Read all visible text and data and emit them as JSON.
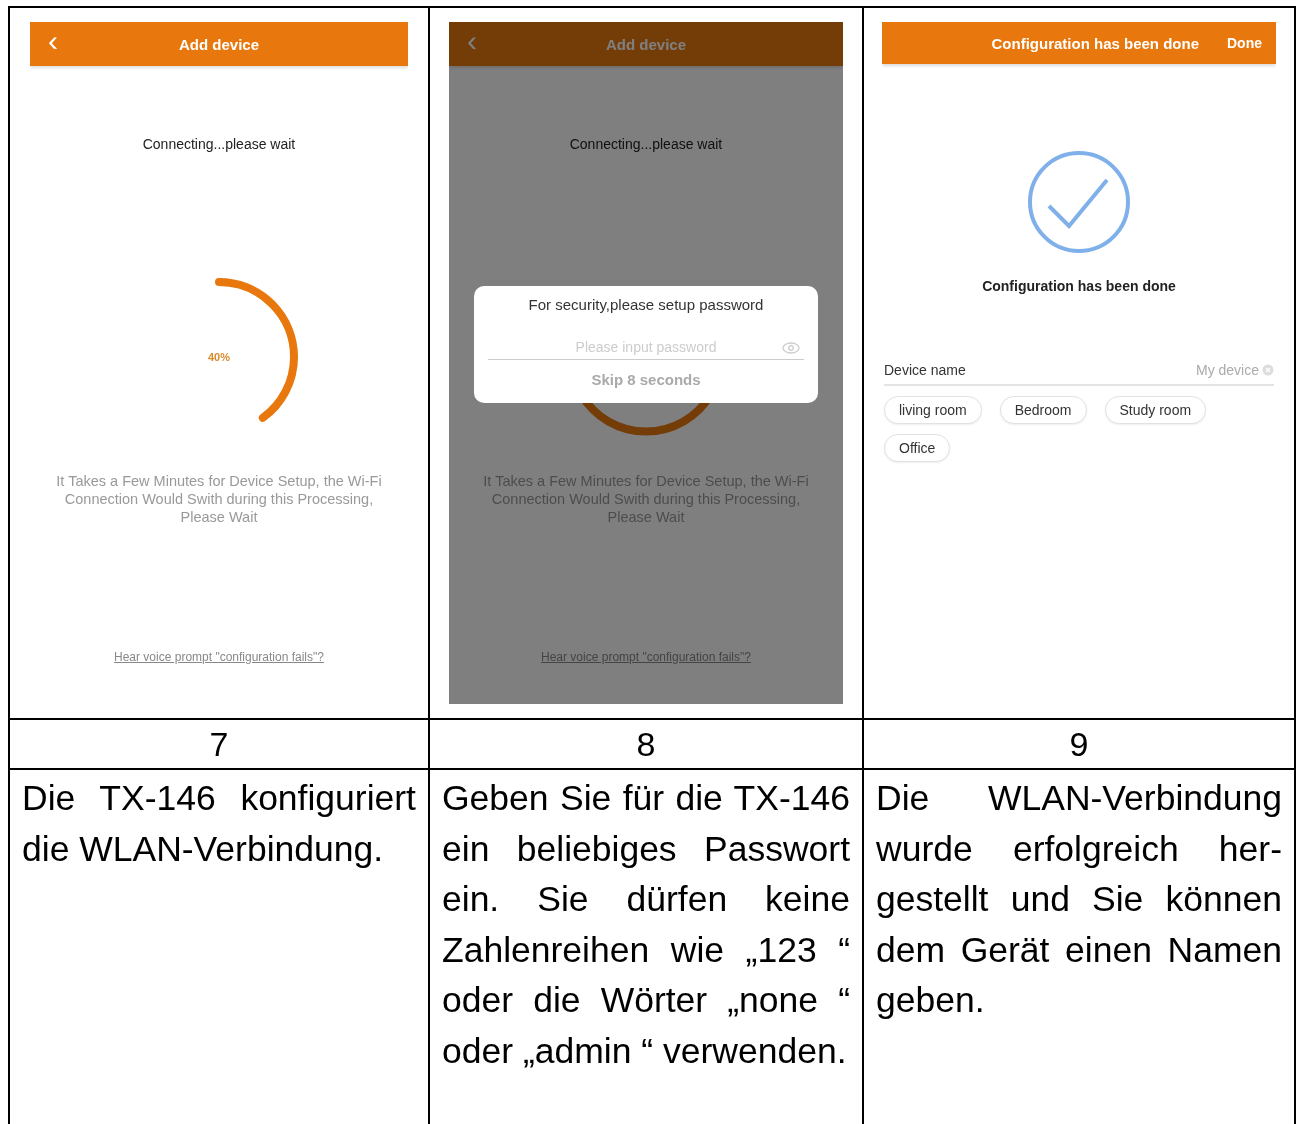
{
  "columns": [
    {
      "screen": {
        "kind": "progress",
        "header": {
          "back": "‹",
          "title": "Add device"
        },
        "status": "Connecting...please wait",
        "level": 0.4,
        "percent": "40%",
        "note": "It Takes a Few Minutes for Device Setup, the Wi-Fi Connection Would Swith during this Processing, Please Wait",
        "link": "Hear voice prompt \"configuration fails\"?"
      },
      "number": "7",
      "description": "Die TX-146 konfiguriert die WLAN-Verbindung."
    },
    {
      "screen": {
        "kind": "progress",
        "header": {
          "back": "‹",
          "title": "Add device"
        },
        "status": "Connecting...please wait",
        "note": "It Takes a Few Minutes for Device Setup, the Wi-Fi Connection Would Swith during this Processing, Please Wait",
        "link": "Hear voice prompt \"configuration fails\"?",
        "dialog": {
          "title": "For security,please setup password",
          "placeholder": "Please input password",
          "skip": "Skip 8 seconds"
        }
      },
      "number": "8",
      "description": "Geben Sie für die TX-146 ein beliebiges Passwort ein. Sie dürfen keine Zahlenreihen wie „123 “ oder die Wörter „none “ oder „admin “ verwenden."
    },
    {
      "screen": {
        "kind": "done",
        "header": {
          "title": "Configuration has been done",
          "action": "Done"
        },
        "message": "Configuration has been done",
        "field": {
          "label": "Device name",
          "value": "My device"
        },
        "chips": [
          {
            "label": "living room",
            "selected": false
          },
          {
            "label": "Bedroom",
            "selected": false
          },
          {
            "label": "Study room",
            "selected": false
          },
          {
            "label": "Office",
            "selected": false
          }
        ]
      },
      "number": "9",
      "description": "Die WLAN-Verbindung wurde erfolgreich her-gestellt und Sie können dem Gerät einen Namen geben."
    }
  ]
}
